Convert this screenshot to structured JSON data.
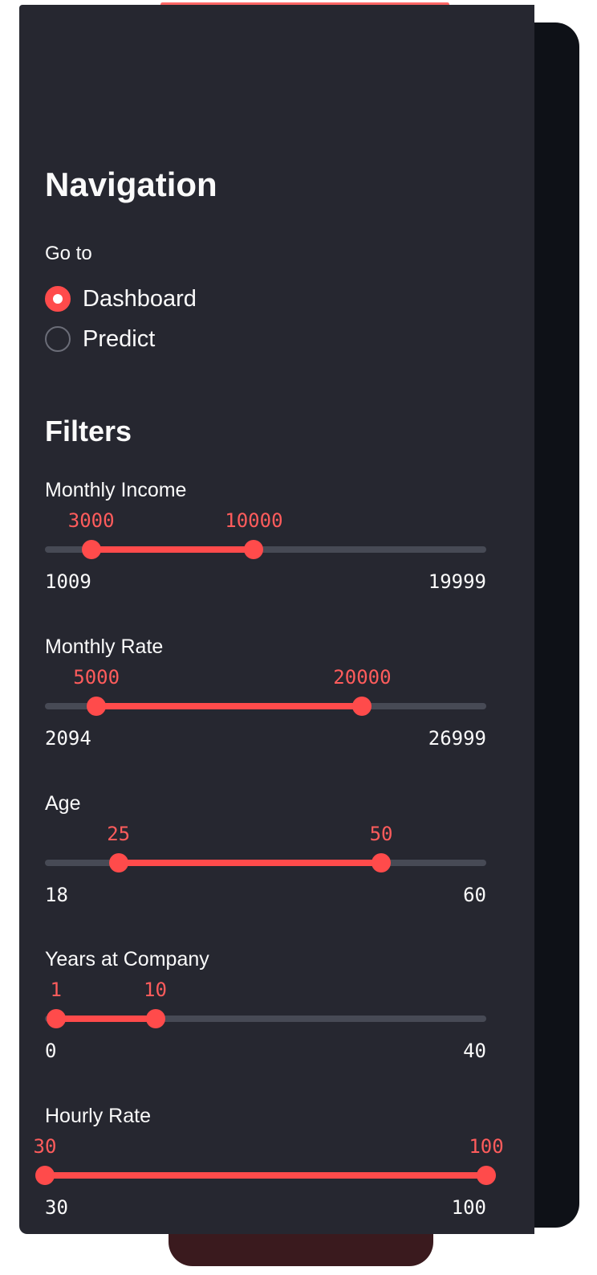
{
  "colors": {
    "accent": "#ff4b4b",
    "sidebar_bg": "#262730",
    "main_bg": "#0e1117",
    "track": "#474a55",
    "text": "#fafafa"
  },
  "sidebar": {
    "nav_title": "Navigation",
    "goto_label": "Go to",
    "radio_options": [
      {
        "label": "Dashboard",
        "selected": true
      },
      {
        "label": "Predict",
        "selected": false
      }
    ],
    "filters_title": "Filters",
    "sliders": [
      {
        "label": "Monthly Income",
        "min": 1009,
        "max": 19999,
        "low": 3000,
        "high": 10000
      },
      {
        "label": "Monthly Rate",
        "min": 2094,
        "max": 26999,
        "low": 5000,
        "high": 20000
      },
      {
        "label": "Age",
        "min": 18,
        "max": 60,
        "low": 25,
        "high": 50
      },
      {
        "label": "Years at Company",
        "min": 0,
        "max": 40,
        "low": 1,
        "high": 10
      },
      {
        "label": "Hourly Rate",
        "min": 30,
        "max": 100,
        "low": 30,
        "high": 100
      }
    ]
  }
}
